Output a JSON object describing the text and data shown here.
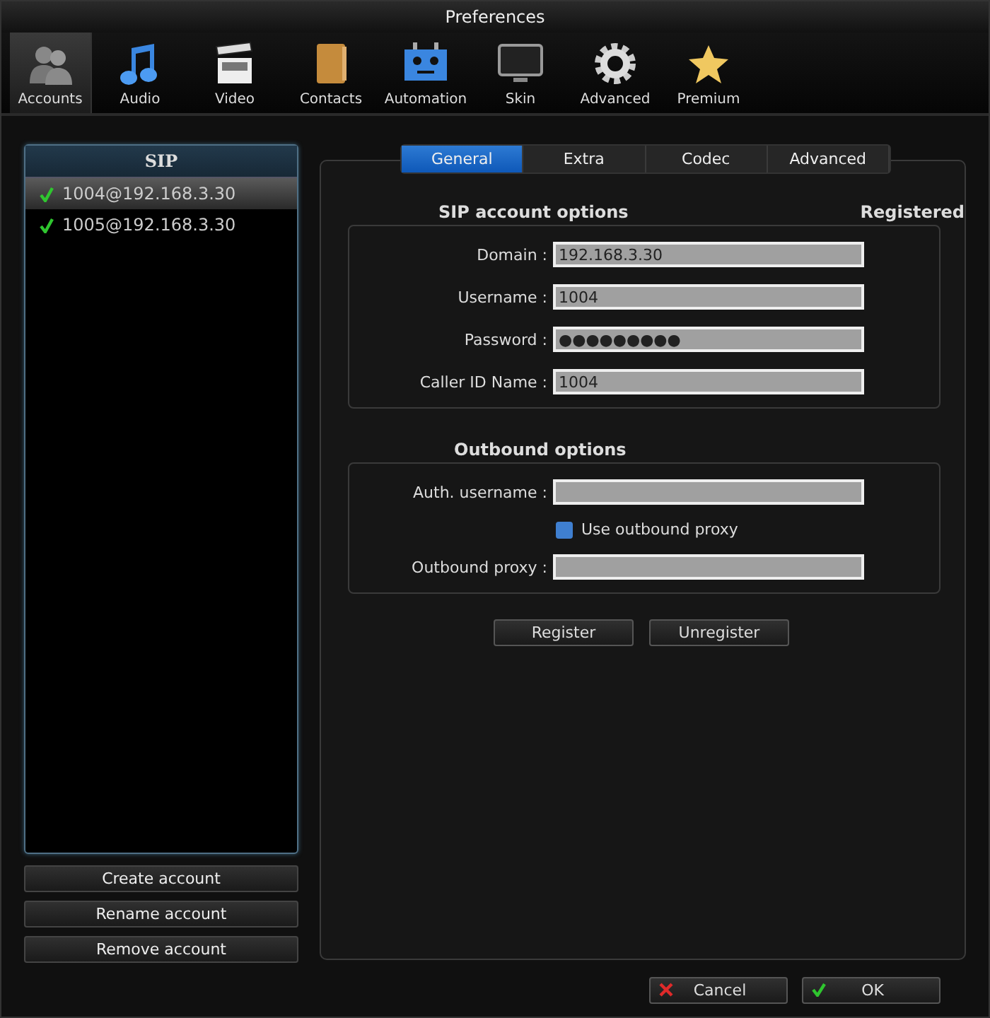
{
  "window": {
    "title": "Preferences"
  },
  "toolbar": [
    {
      "label": "Accounts",
      "selected": true
    },
    {
      "label": "Audio",
      "selected": false
    },
    {
      "label": "Video",
      "selected": false
    },
    {
      "label": "Contacts",
      "selected": false
    },
    {
      "label": "Automation",
      "selected": false
    },
    {
      "label": "Skin",
      "selected": false
    },
    {
      "label": "Advanced",
      "selected": false
    },
    {
      "label": "Premium",
      "selected": false
    }
  ],
  "accounts": {
    "header": "SIP",
    "items": [
      {
        "label": "1004@192.168.3.30",
        "selected": true
      },
      {
        "label": "1005@192.168.3.30",
        "selected": false
      }
    ],
    "buttons": [
      "Create account",
      "Rename account",
      "Remove account"
    ]
  },
  "tabs": [
    {
      "label": "General",
      "selected": true
    },
    {
      "label": "Extra",
      "selected": false
    },
    {
      "label": "Codec",
      "selected": false
    },
    {
      "label": "Advanced",
      "selected": false
    }
  ],
  "sip_options": {
    "title": "SIP account options",
    "status": "Registered",
    "fields": [
      {
        "label": "Domain :",
        "value": "192.168.3.30"
      },
      {
        "label": "Username :",
        "value": "1004"
      },
      {
        "label": "Password :",
        "value": "●●●●●●●●●"
      },
      {
        "label": "Caller ID Name :",
        "value": "1004"
      }
    ]
  },
  "outbound_options": {
    "title": "Outbound options",
    "items": [
      {
        "kind": "field",
        "label": "Auth. username :"
      },
      {
        "kind": "checkbox",
        "label": "Use outbound proxy",
        "checked": false
      },
      {
        "kind": "field",
        "label": "Outbound proxy :"
      }
    ]
  },
  "actions": [
    "Register",
    "Unregister"
  ],
  "footer": [
    {
      "label": "Cancel",
      "kind": "cancel"
    },
    {
      "label": "OK",
      "kind": "ok"
    }
  ]
}
